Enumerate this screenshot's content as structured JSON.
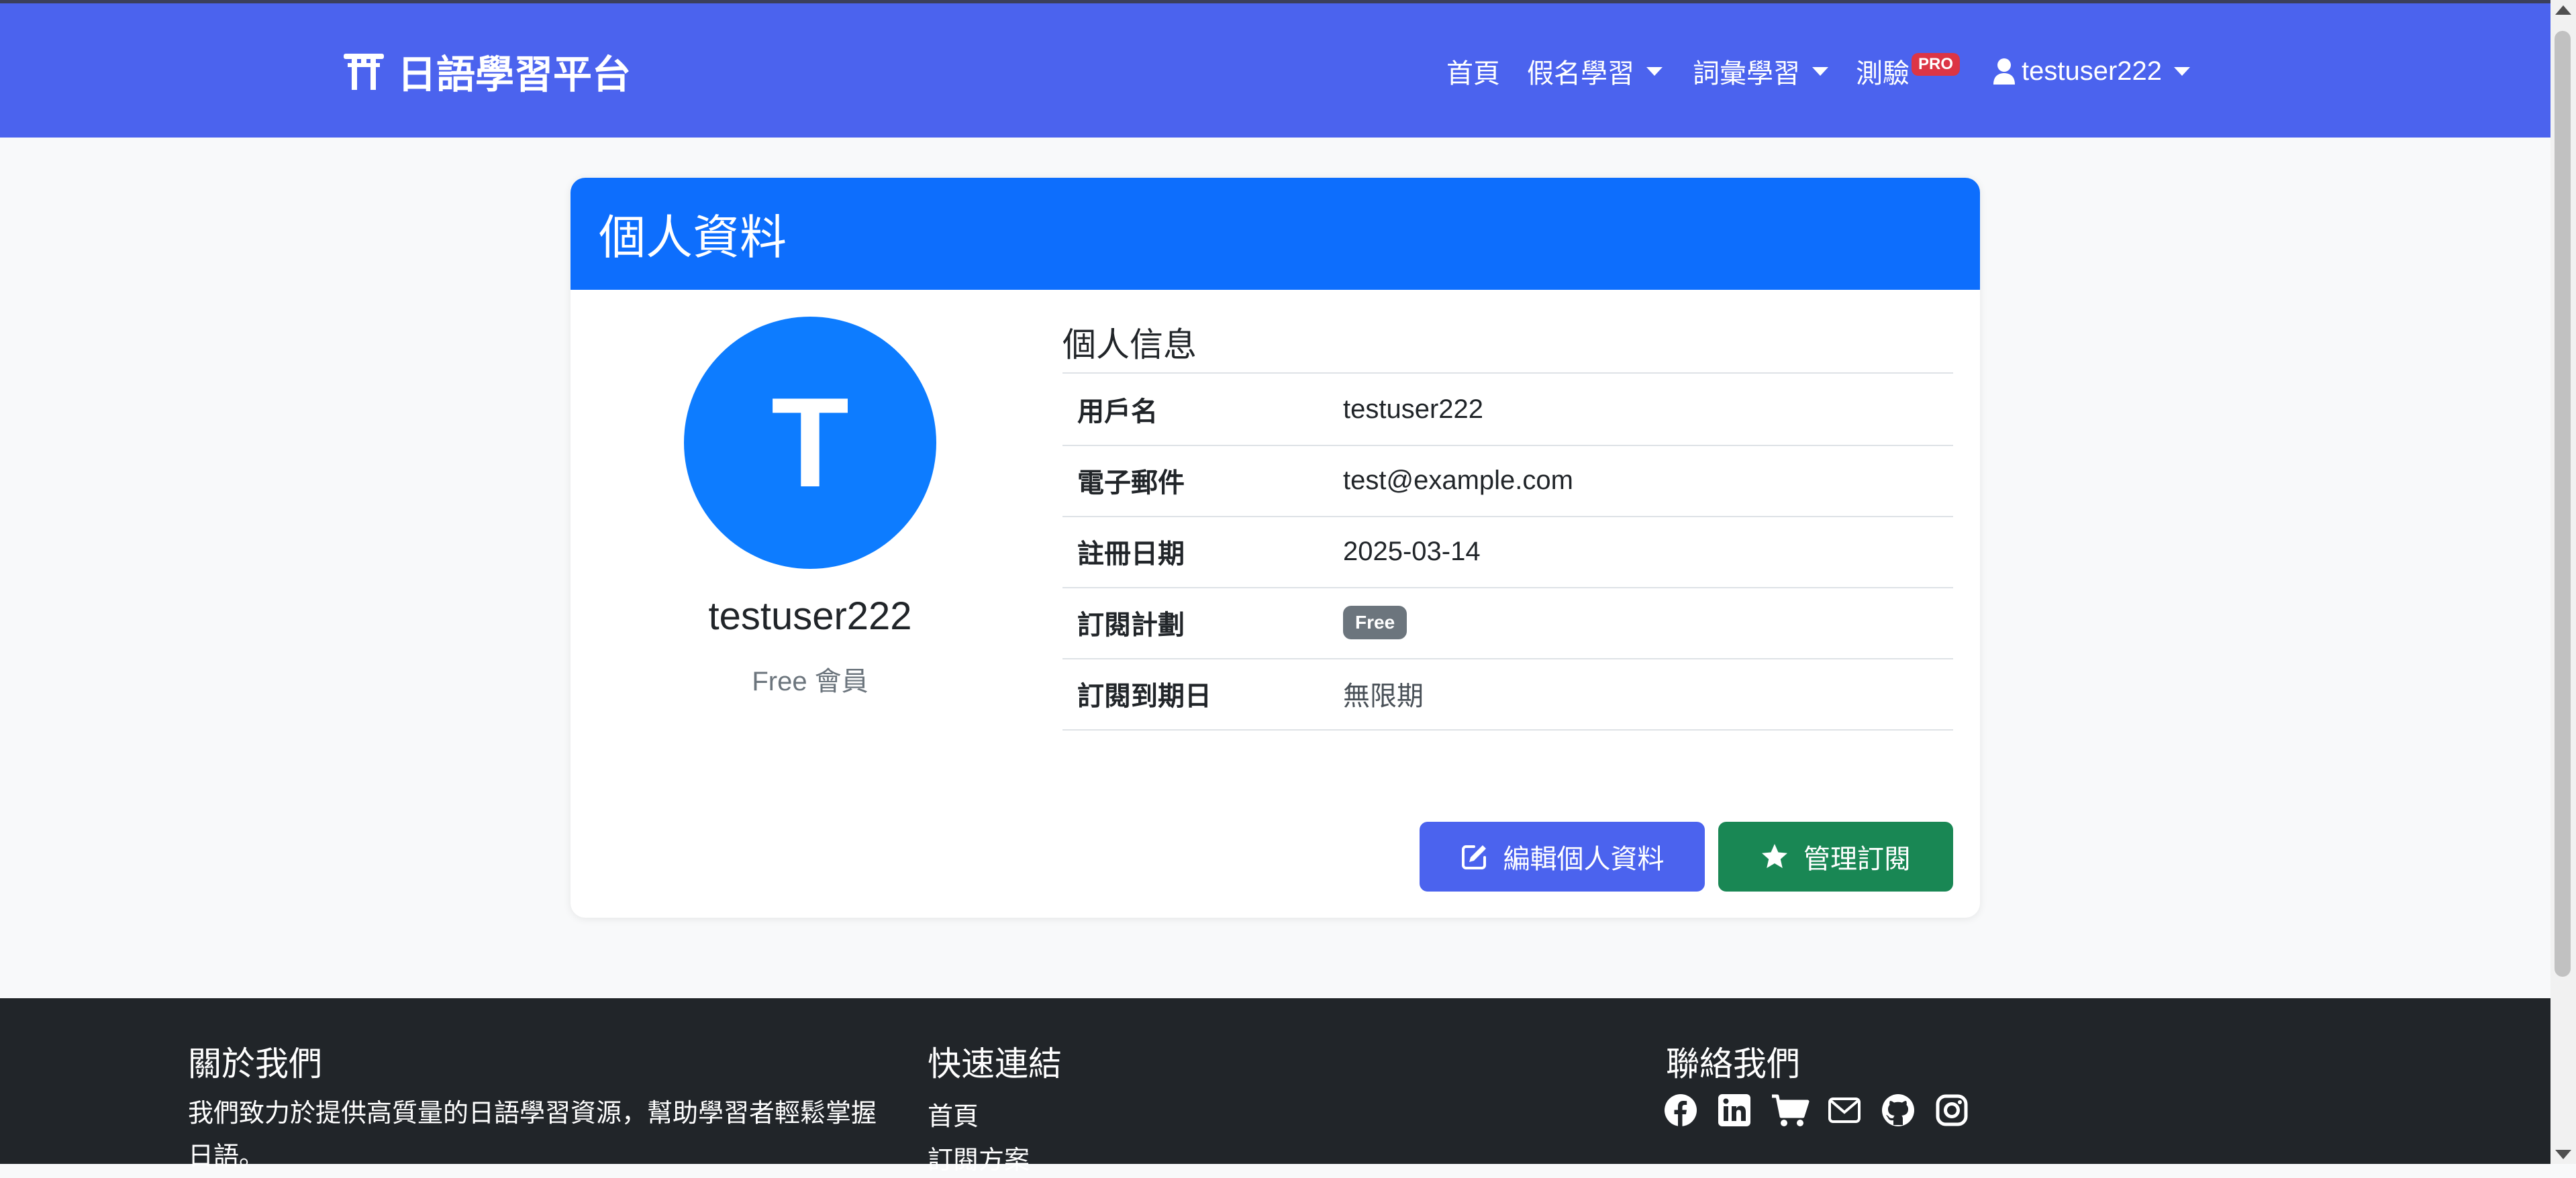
{
  "brand": {
    "name": "日語學習平台"
  },
  "nav": {
    "home": "首頁",
    "kana": "假名學習",
    "vocab": "詞彙學習",
    "quiz": "測驗",
    "quiz_badge": "PRO",
    "user": "testuser222"
  },
  "card": {
    "title": "個人資料"
  },
  "profile": {
    "avatar_letter": "T",
    "username": "testuser222",
    "plan": "Free 會員"
  },
  "info": {
    "section_title": "個人信息",
    "rows": [
      {
        "label": "用戶名",
        "value": "testuser222"
      },
      {
        "label": "電子郵件",
        "value": "test@example.com"
      },
      {
        "label": "註冊日期",
        "value": "2025-03-14"
      },
      {
        "label": "訂閱計劃",
        "value": "Free"
      },
      {
        "label": "訂閱到期日",
        "value": "無限期"
      }
    ]
  },
  "buttons": {
    "edit": "編輯個人資料",
    "subscription": "管理訂閱"
  },
  "footer": {
    "about_title": "關於我們",
    "about_text": "我們致力於提供高質量的日語學習資源，幫助學習者輕鬆掌握日語。",
    "links_title": "快速連結",
    "links": [
      "首頁",
      "訂閱方案"
    ],
    "contact_title": "聯絡我們",
    "social_icons": [
      "facebook-icon",
      "linkedin-icon",
      "cart-icon",
      "envelope-icon",
      "github-icon",
      "instagram-icon"
    ]
  },
  "colors": {
    "navbar": "#4b63ee",
    "card_header": "#0d6efd",
    "avatar": "#0d7cff",
    "edit_button": "#4b63ee",
    "subscription_button": "#198754",
    "footer": "#212529",
    "pro_badge": "#dc3545",
    "plan_badge": "#6c757d"
  }
}
